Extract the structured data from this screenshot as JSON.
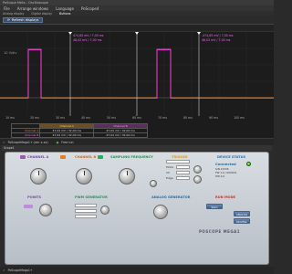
{
  "window": {
    "title": "PoScope Meta - Oscilloscope"
  },
  "menu": [
    "File",
    "Arrange windows",
    "Language",
    "PoScope4"
  ],
  "tabs": [
    "Analog display",
    "Digital display",
    "Buttons"
  ],
  "toolbar": {
    "refresh_label": "Refresh displays"
  },
  "scope": {
    "scale_label": "10 V/div",
    "cursor_readouts": [
      {
        "ch1": "474,65 mV / 7,00 ms",
        "ch2": "48,02 mV / 7,00 ms"
      },
      {
        "ch1": "-474,65 mV / 7,00 ms",
        "ch2": "48,02 mV / 7,00 ms"
      }
    ],
    "x_ticks": [
      "10 ms",
      "20 ms",
      "30 ms",
      "40 ms",
      "50 ms",
      "60 ms",
      "70 ms",
      "80 ms",
      "90 ms",
      "100 ms"
    ],
    "colors": {
      "channel_a": "#ff8a2a",
      "channel_b": "#ff33ff",
      "cursor": "#cfcfcf"
    }
  },
  "measurements": {
    "headers": [
      "",
      "Channel A",
      "Channel B"
    ],
    "rows": [
      {
        "label": "Channel A",
        "a": "47,04 mV / 32,00 ms",
        "b": "47,04 mV / 32,00 ms"
      },
      {
        "label": "Channel B",
        "a": "47,04 mV / 32,00 ms",
        "b": "47,04 mV / 32,00 ms"
      }
    ]
  },
  "statusbar": {
    "item1": "PoScopeMega1+ (ver. x.xx)",
    "item2": "Free run"
  },
  "panel": {
    "title": "Scope1"
  },
  "device": {
    "channel_a": "CHANNEL A",
    "channel_b": "CHANNEL B",
    "sampling": "SAMPLING FREQUENCY",
    "trigger": "TRIGGER",
    "device_status": "DEVICE STATUS",
    "status_connected": "Connected",
    "status_lines": [
      "S/N 12345",
      "FW 1.0 / 000019",
      "HW 4.0"
    ],
    "points": "POINTS",
    "pwm_gen": "PWM GENERATOR",
    "analog_gen": "ANALOG GENERATOR",
    "run_mode": "RUN MODE",
    "trigger_fields": [
      "Source",
      "Mode",
      "Ch",
      "Edge",
      "Level"
    ],
    "buttons": {
      "analog": "ANALOG",
      "digital": "DIGITAL",
      "start": "Start"
    },
    "brand": "POSCOPE MEGA1"
  },
  "footer": {
    "item1": "PoScopeMega1+"
  }
}
